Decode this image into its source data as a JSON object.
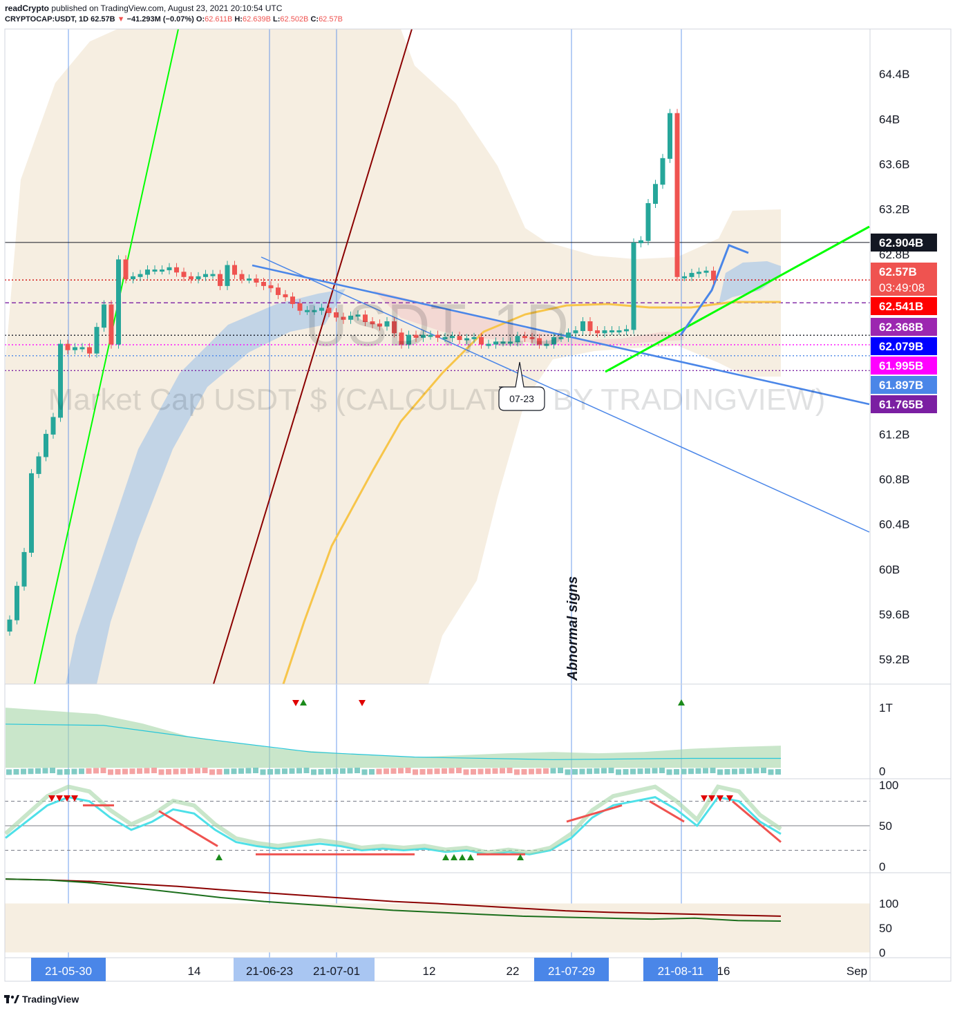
{
  "header": {
    "publisher": "readCrypto",
    "published_text": "published on TradingView.com, August 23, 2021 20:10:54 UTC",
    "symbol": "CRYPTOCAP:USDT, 1D",
    "last": "62.57B",
    "change": "−41.293M (−0.07%)",
    "o_label": "O:",
    "o": "62.611B",
    "h_label": "H:",
    "h": "62.639B",
    "l_label": "L:",
    "l": "62.502B",
    "c_label": "C:",
    "c": "62.57B"
  },
  "watermark": {
    "big": "USDT, 1D",
    "sub": "Market Cap USDT, $ (CALCULATED BY TRADINGVIEW)"
  },
  "annotations": {
    "callout": "07-23",
    "vertical_note": "Abnormal signs"
  },
  "footer": {
    "brand": "TradingView"
  },
  "colors": {
    "up": "#26a69a",
    "down": "#ef5350",
    "green_line": "#00ff00",
    "darkred_line": "#8b0000",
    "blue_line": "#4a86e8",
    "ma_yellow": "#f7c54a",
    "band_fill": "#f6eee1",
    "ribbon": "#b8cfe6"
  },
  "chart_data": [
    {
      "type": "candlestick",
      "title": "USDT, 1D",
      "ylabel": "Market Cap USDT, $",
      "y_tick_labels": [
        "64.4B",
        "64B",
        "63.6B",
        "63.2B",
        "62.8B",
        "61.2B",
        "60.8B",
        "60.4B",
        "60B",
        "59.6B",
        "59.2B"
      ],
      "y_ticks": [
        64.4,
        64.0,
        63.6,
        63.2,
        62.8,
        61.2,
        60.8,
        60.4,
        60.0,
        59.6,
        59.2
      ],
      "ylim": [
        58.98,
        64.8
      ],
      "x_tick_labels": [
        "21-05-30",
        "14",
        "21-06-23",
        "21-07-01",
        "12",
        "22",
        "21-07-29",
        "21-08-11",
        "16",
        "Sep"
      ],
      "price_tags": [
        {
          "label": "62.904B",
          "value": 62.904,
          "bg": "#131722"
        },
        {
          "label": "62.57B",
          "value": 62.57,
          "bg": "#ef5350",
          "sub": "03:49:08"
        },
        {
          "label": "62.541B",
          "value": 62.38,
          "bg": "#ff0000"
        },
        {
          "label": "62.368B",
          "value": 62.368,
          "bg": "#9c27b0"
        },
        {
          "label": "62.079B",
          "value": 62.079,
          "bg": "#0000ff"
        },
        {
          "label": "61.995B",
          "value": 61.995,
          "bg": "#ff00ff"
        },
        {
          "label": "61.897B",
          "value": 61.897,
          "bg": "#4a86e8"
        },
        {
          "label": "61.765B",
          "value": 61.765,
          "bg": "#7b1fa2"
        }
      ],
      "closes": [
        59.55,
        59.85,
        60.15,
        60.85,
        61.0,
        61.2,
        61.35,
        62.0,
        61.95,
        61.97,
        61.97,
        61.92,
        62.15,
        62.35,
        62.0,
        62.75,
        62.58,
        62.6,
        62.62,
        62.66,
        62.66,
        62.66,
        62.68,
        62.64,
        62.6,
        62.58,
        62.6,
        62.62,
        62.62,
        62.52,
        62.7,
        62.62,
        62.58,
        62.58,
        62.55,
        62.52,
        62.5,
        62.44,
        62.42,
        62.36,
        62.3,
        62.3,
        62.3,
        62.32,
        62.28,
        62.24,
        62.22,
        62.25,
        62.26,
        62.2,
        62.18,
        62.16,
        62.2,
        62.1,
        62.0,
        62.08,
        62.06,
        62.08,
        62.08,
        62.06,
        62.06,
        62.07,
        62.04,
        62.05,
        62.06,
        62.0,
        62.0,
        62.02,
        62.02,
        62.02,
        62.07,
        62.06,
        62.05,
        62.0,
        62.0,
        62.06,
        62.06,
        62.1,
        62.12,
        62.2,
        62.12,
        62.1,
        62.12,
        62.12,
        62.12,
        62.13,
        62.9,
        62.92,
        63.25,
        63.42,
        63.65,
        64.05,
        62.6,
        62.6,
        62.63,
        62.64,
        62.65,
        62.57
      ],
      "series": [
        {
          "name": "Ribbon band",
          "type": "area"
        },
        {
          "name": "Moving average",
          "type": "line"
        },
        {
          "name": "Trend lines",
          "type": "line"
        }
      ]
    },
    {
      "type": "area",
      "title": "",
      "y_tick_labels": [
        "1T",
        "0"
      ],
      "y_ticks": [
        1.0,
        0.0
      ],
      "ylim": [
        -0.1,
        1.35
      ],
      "series": [
        {
          "name": "Volume",
          "values": [
            1.0,
            0.95,
            0.9,
            0.75,
            0.55,
            0.45,
            0.35,
            0.3,
            0.25,
            0.22,
            0.25,
            0.28,
            0.3,
            0.28,
            0.3,
            0.35,
            0.38,
            0.4
          ]
        }
      ]
    },
    {
      "type": "line",
      "title": "",
      "y_tick_labels": [
        "100",
        "50",
        "0"
      ],
      "y_ticks": [
        100,
        50,
        0
      ],
      "ylim": [
        -5,
        105
      ],
      "series": [
        {
          "name": "",
          "values": [
            35,
            55,
            75,
            85,
            80,
            60,
            45,
            55,
            70,
            65,
            45,
            30,
            25,
            22,
            25,
            28,
            25,
            20,
            22,
            20,
            22,
            18,
            20,
            15,
            18,
            15,
            20,
            35,
            60,
            75,
            80,
            85,
            70,
            50,
            85,
            80,
            55,
            40
          ]
        }
      ]
    },
    {
      "type": "line",
      "title": "",
      "y_tick_labels": [
        "100",
        "50",
        "0"
      ],
      "y_ticks": [
        100,
        50,
        0
      ],
      "ylim": [
        -8,
        160
      ],
      "series": [
        {
          "name": "",
          "values": [
            150,
            148,
            145,
            140,
            135,
            128,
            122,
            116,
            110,
            104,
            100,
            95,
            90,
            85,
            82,
            80,
            78,
            76,
            74
          ]
        },
        {
          "name": "",
          "values": [
            150,
            148,
            142,
            132,
            122,
            112,
            104,
            98,
            92,
            86,
            82,
            78,
            74,
            72,
            70,
            68,
            70,
            65,
            64
          ]
        }
      ]
    }
  ]
}
